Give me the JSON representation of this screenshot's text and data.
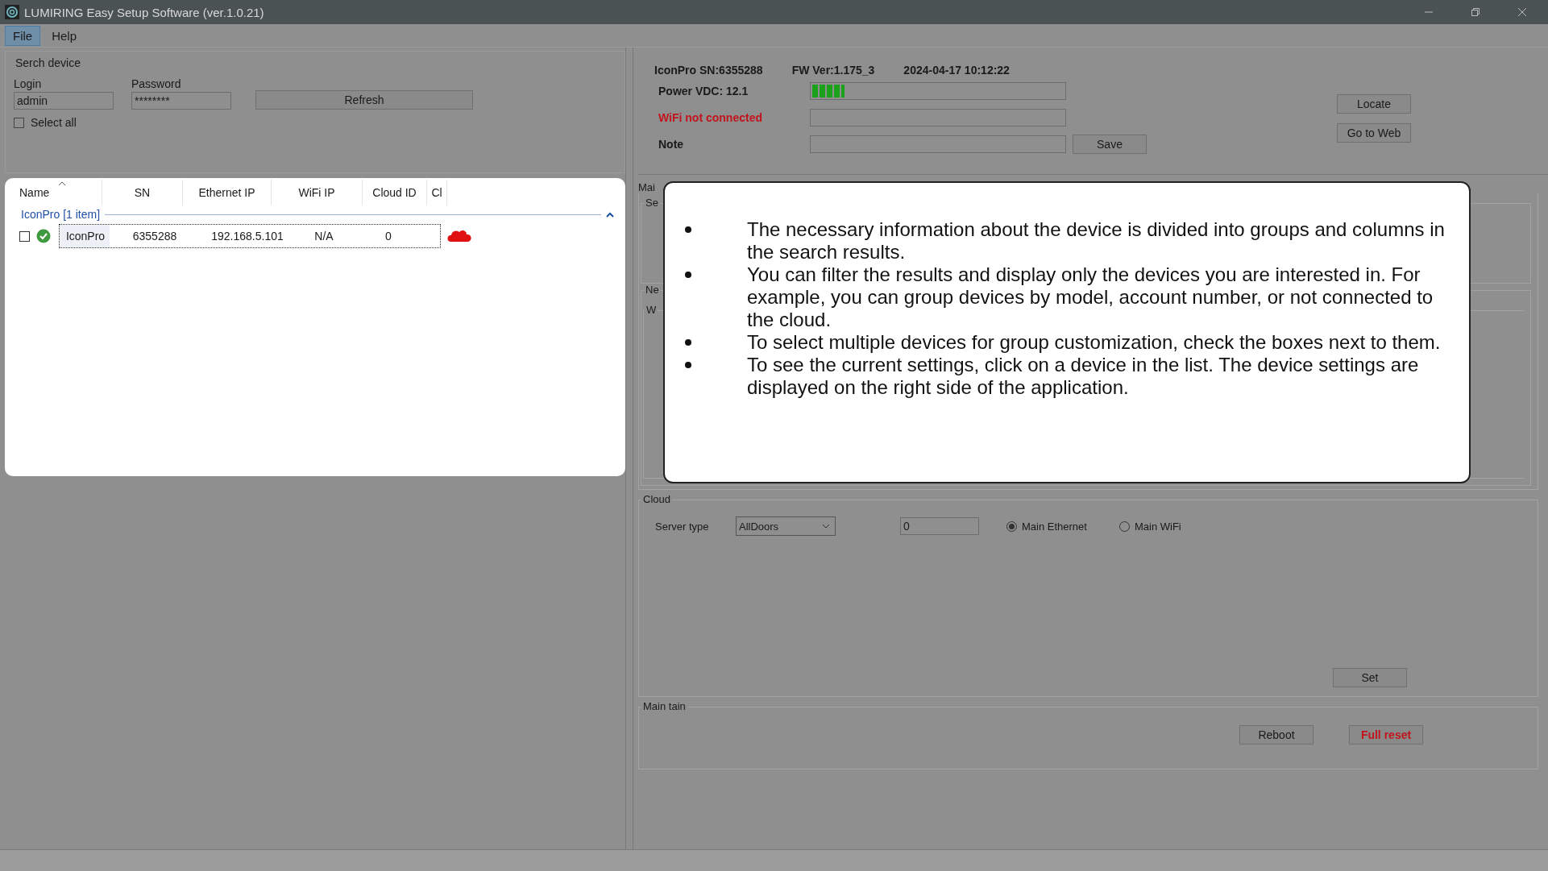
{
  "window": {
    "title": "LUMIRING Easy Setup Software (ver.1.0.21)"
  },
  "menu": [
    {
      "label": "File",
      "selected": true
    },
    {
      "label": "Help",
      "selected": false
    }
  ],
  "search": {
    "title": "Serch device",
    "login_label": "Login",
    "login_value": "admin",
    "password_label": "Password",
    "password_value": "********",
    "refresh": "Refresh",
    "select_all": {
      "label": "Select all",
      "checked": false
    }
  },
  "device_list": {
    "columns": [
      "Name",
      "SN",
      "Ethernet IP",
      "WiFi IP",
      "Cloud ID",
      "Cl"
    ],
    "groups": [
      {
        "label": "IconPro [1 item]",
        "expanded": true,
        "rows": [
          {
            "checked": false,
            "online": true,
            "name": "IconPro",
            "sn": "6355288",
            "ethernet_ip": "192.168.5.101",
            "wifi_ip": "N/A",
            "cloud_id": "0",
            "cloud_connected": false
          }
        ]
      }
    ]
  },
  "device_info": {
    "model_sn": "IconPro SN:6355288",
    "fw": "FW Ver:1.175_3",
    "datetime": "2024-04-17 10:12:22",
    "power_label": "Power VDC: 12.1",
    "power": {
      "level": 0.14
    },
    "wifi_label": "WiFi not connected",
    "wifi_connected": false,
    "note_label": "Note",
    "save": "Save",
    "locate": "Locate",
    "go_to_web": "Go to Web"
  },
  "hidden_groups": {
    "tab": "Mai",
    "group_1": "Se",
    "group_2": "Ne",
    "group_3": "W"
  },
  "popup": {
    "bullets": [
      "The necessary information about the device is divided into groups and columns in the search results.",
      "You can filter the results and display only the devices you are interested in. For example, you can group devices by model, account number, or not connected to the cloud.",
      "To select multiple devices for group customization, check the boxes next to them.",
      "To see the current settings, click on a device in the list. The device settings are displayed on the right side of the application."
    ]
  },
  "cloud": {
    "title": "Cloud",
    "server_type_label": "Server type",
    "server_type": "AllDoors",
    "cloud_id": "0",
    "radios": [
      {
        "label": "Main Ethernet",
        "selected": true
      },
      {
        "label": "Main WiFi",
        "selected": false
      }
    ],
    "set": "Set"
  },
  "maintain": {
    "title": "Main tain",
    "buttons": [
      {
        "label": "Reboot",
        "kind": "normal"
      },
      {
        "label": "Full reset",
        "kind": "danger"
      }
    ]
  }
}
